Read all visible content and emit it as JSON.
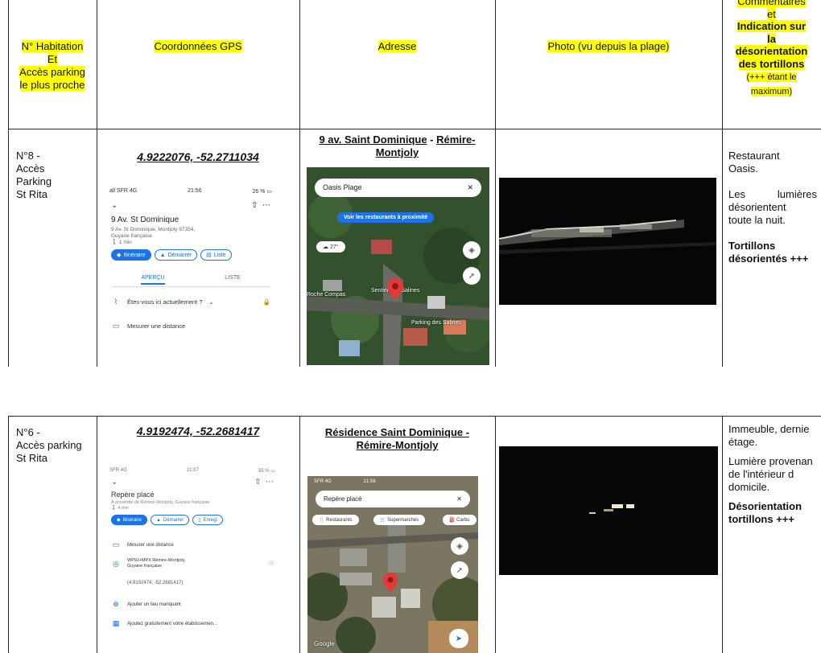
{
  "table1": {
    "headers": {
      "habitation": [
        "N° Habitation",
        "Et",
        "Accès parking",
        "le plus proche"
      ],
      "gps": "Coordonnées GPS",
      "adresse": "Adresse",
      "photo": "Photo (vu depuis la plage)",
      "comments": [
        "Commentaires",
        "et",
        "Indication sur",
        "la",
        "désorientation",
        "des tortillons",
        "(+++ étant le",
        "maximum)"
      ]
    },
    "row": {
      "habitation": [
        "N°8 -",
        "Accès",
        "Parking",
        "St Rita"
      ],
      "gps": "4.9222076, -52.2711034",
      "address": [
        "9 av. Saint Dominique",
        " - ",
        "Rémire-",
        "Montjoly"
      ],
      "comments": {
        "line1": [
          "Restaurant",
          "Oasis."
        ],
        "line2": [
          "Les",
          "lumières",
          "désorientent",
          "toute la nuit."
        ],
        "bold": [
          "Tortillons",
          "désorientés +++"
        ]
      }
    },
    "phone": {
      "status_left": "all SFR 4G",
      "status_time": "21:56",
      "status_right": "26 %",
      "place_title": "9 Av. St Dominique",
      "place_addr": [
        "9 Av. St Dominique, Montjoly 97354,",
        "Guyane française"
      ],
      "walk": "1 min",
      "btn_route": "Itinéraire",
      "btn_start": "Démarrer",
      "btn_list": "Liste",
      "tab1": "APERÇU",
      "tab2": "LISTE",
      "q": "Êtes-vous ici actuellement ?",
      "measure": "Mesurer une distance"
    },
    "map": {
      "search": "Oasis Plage",
      "chip": "Voir les restaurants à proximité",
      "temp": "27°",
      "label_roche": "Roche Compas",
      "label_sentier": "Sentier des Salines",
      "label_parking": "Parking des Salines"
    }
  },
  "table2": {
    "row": {
      "habitation": [
        "N°6 -",
        "Accès parking",
        "St Rita"
      ],
      "gps": "4.9192474, -52.2681417",
      "address": [
        "Résidence Saint Dominique -",
        "Rémire-Montjoly"
      ],
      "comments": {
        "line1": [
          "Immeuble, dernie",
          "étage."
        ],
        "line2": [
          "Lumière provenan",
          "de l'intérieur d",
          "domicile."
        ],
        "bold": [
          "Désorientation",
          "tortillons +++"
        ]
      }
    },
    "phone": {
      "status_left": "SFR 4G",
      "status_time": "21:57",
      "status_right": "55 %",
      "place_title": "Repère placé",
      "place_sub": "À proximité de Rémire-Montjoly, Guyane française",
      "walk": "4 min",
      "btn_route": "Itinéraire",
      "btn_start": "Démarrer",
      "btn_save": "Enregi",
      "measure": "Mesurer une distance",
      "pluscode": [
        "WP9J+MPX Rémire-Montjoly,",
        "Guyane française"
      ],
      "coords": "(4.9192474, -52.2681417)",
      "add_place": "Ajouter un lieu manquant",
      "add_business": "Ajoutez gratuitement votre établissemen..."
    },
    "map": {
      "status_left": "SFR 4G",
      "status_time": "21:56",
      "search": "Repère placé",
      "chip1": "Restaurants",
      "chip2": "Supermarchés",
      "chip3": "Carbu",
      "watermark": "Google"
    }
  },
  "colors": {
    "highlight": "#ffff00",
    "map_green": "#2f4a2a",
    "pin_red": "#e53935",
    "google_blue": "#1a73e8"
  }
}
